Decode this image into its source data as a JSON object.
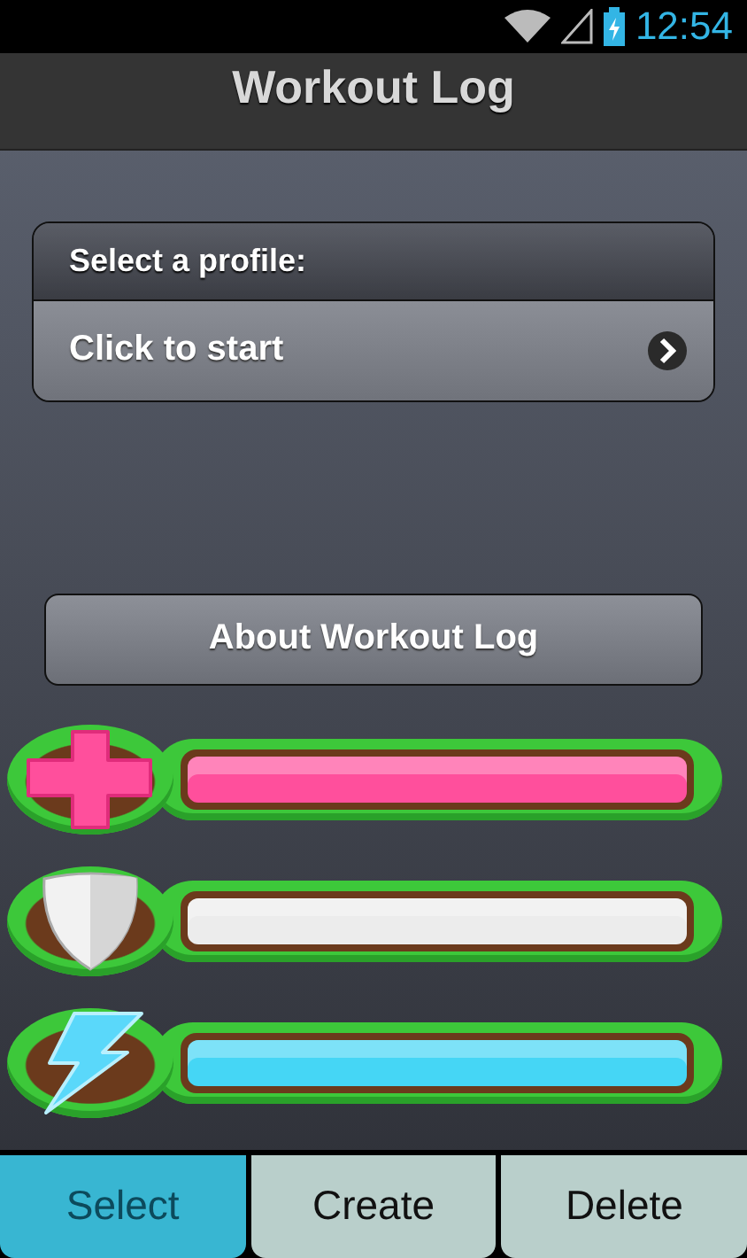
{
  "status_bar": {
    "time": "12:54"
  },
  "header": {
    "title": "Workout Log"
  },
  "profile": {
    "heading": "Select a profile:",
    "action": "Click to start"
  },
  "about_button": "About Workout Log",
  "stat_bars": [
    {
      "kind": "health",
      "level": 1,
      "color": "#ff4f9c"
    },
    {
      "kind": "shield",
      "level": 1,
      "color": "#ececec"
    },
    {
      "kind": "energy",
      "level": 1,
      "color": "#45d6f5"
    }
  ],
  "tabs": [
    {
      "label": "Select",
      "selected": true
    },
    {
      "label": "Create",
      "selected": false
    },
    {
      "label": "Delete",
      "selected": false
    }
  ]
}
